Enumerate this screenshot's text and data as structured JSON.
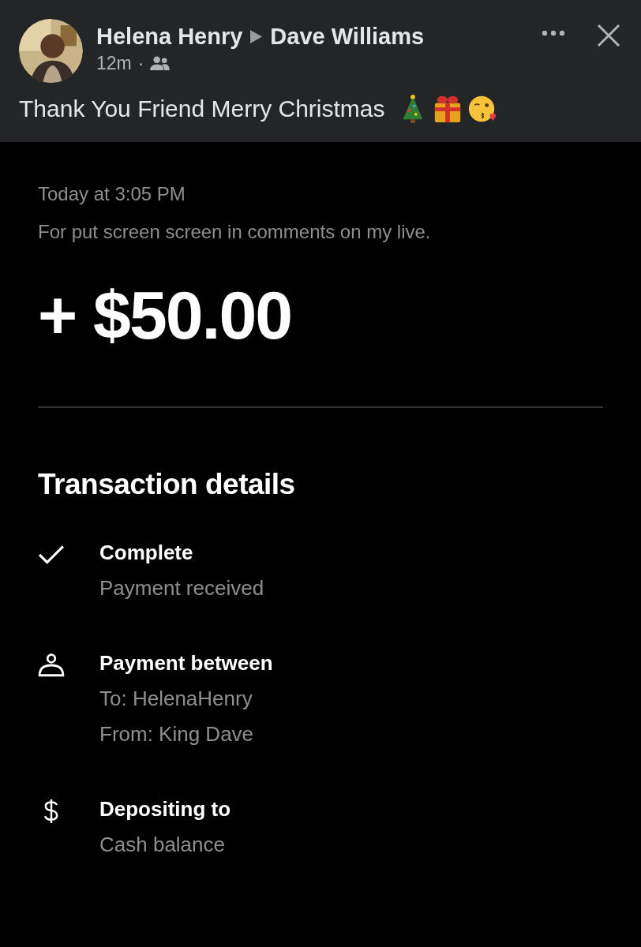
{
  "post": {
    "author": "Helena Henry",
    "recipient": "Dave Williams",
    "time": "12m",
    "separator": "·",
    "message": "Thank You Friend Merry Christmas"
  },
  "receipt": {
    "date": "Today at 3:05 PM",
    "note": "For put screen screen in comments on my live.",
    "amount": "+ $50.00",
    "section_title": "Transaction details",
    "details": [
      {
        "kind": "check",
        "title": "Complete",
        "lines": [
          "Payment received"
        ]
      },
      {
        "kind": "person",
        "title": "Payment between",
        "lines": [
          "To: HelenaHenry",
          "From: King Dave"
        ]
      },
      {
        "kind": "dollar",
        "title": "Depositing to",
        "lines": [
          "Cash balance"
        ]
      }
    ]
  }
}
